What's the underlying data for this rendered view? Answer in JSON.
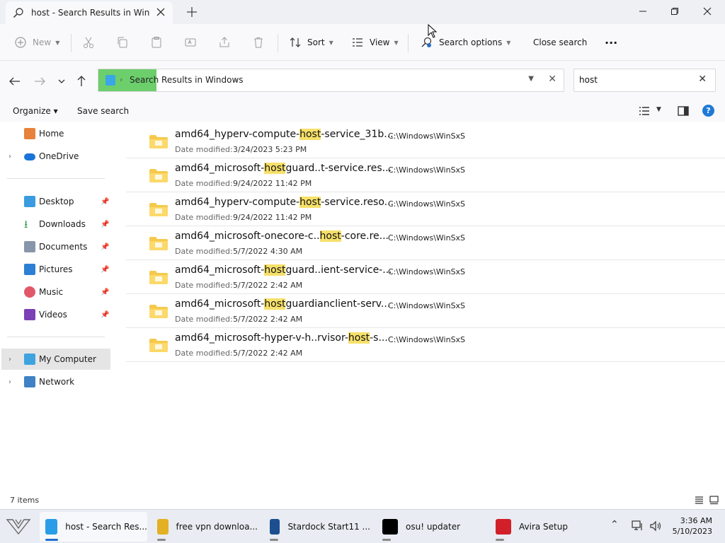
{
  "window": {
    "tab_title": "host - Search Results in Windows"
  },
  "toolbar": {
    "new_label": "New",
    "sort_label": "Sort",
    "view_label": "View",
    "search_options_label": "Search options",
    "close_search_label": "Close search",
    "more_label": "···"
  },
  "address": {
    "crumb": "Search Results in Windows"
  },
  "search": {
    "value": "host"
  },
  "commands": {
    "organize": "Organize",
    "save_search": "Save search"
  },
  "sidebar": {
    "items": [
      {
        "label": "Home",
        "icon": "home-icon",
        "color": "#e8813a"
      },
      {
        "label": "OneDrive",
        "icon": "cloud-icon",
        "color": "#1a73d9"
      },
      {
        "label": "Desktop",
        "icon": "desktop-icon",
        "color": "#3a9be0"
      },
      {
        "label": "Downloads",
        "icon": "download-icon",
        "color": "#2d9a4e"
      },
      {
        "label": "Documents",
        "icon": "document-icon",
        "color": "#7a8aa0"
      },
      {
        "label": "Pictures",
        "icon": "pictures-icon",
        "color": "#2b7fd4"
      },
      {
        "label": "Music",
        "icon": "music-icon",
        "color": "#e2566a"
      },
      {
        "label": "Videos",
        "icon": "video-icon",
        "color": "#7b3fb6"
      },
      {
        "label": "My Computer",
        "icon": "computer-icon",
        "color": "#3fa3e0"
      },
      {
        "label": "Network",
        "icon": "network-icon",
        "color": "#3f82c6"
      }
    ]
  },
  "files": {
    "date_label": "Date modified:",
    "items": [
      {
        "pre": "amd64_hyperv-compute-",
        "hl": "host",
        "post": "-service_31b...",
        "date": "3/24/2023 5:23 PM",
        "path": "C:\\Windows\\WinSxS"
      },
      {
        "pre": "amd64_microsoft-",
        "hl": "host",
        "post": "guard..t-service.res...",
        "date": "9/24/2022 11:42 PM",
        "path": "C:\\Windows\\WinSxS"
      },
      {
        "pre": "amd64_hyperv-compute-",
        "hl": "host",
        "post": "-service.reso...",
        "date": "9/24/2022 11:42 PM",
        "path": "C:\\Windows\\WinSxS"
      },
      {
        "pre": "amd64_microsoft-onecore-c..",
        "hl": "host",
        "post": "-core.re...",
        "date": "5/7/2022 4:30 AM",
        "path": "C:\\Windows\\WinSxS"
      },
      {
        "pre": "amd64_microsoft-",
        "hl": "host",
        "post": "guard..ient-service-...",
        "date": "5/7/2022 2:42 AM",
        "path": "C:\\Windows\\WinSxS"
      },
      {
        "pre": "amd64_microsoft-",
        "hl": "host",
        "post": "guardianclient-serv...",
        "date": "5/7/2022 2:42 AM",
        "path": "C:\\Windows\\WinSxS"
      },
      {
        "pre": "amd64_microsoft-hyper-v-h..rvisor-",
        "hl": "host",
        "post": "-s...",
        "date": "5/7/2022 2:42 AM",
        "path": "C:\\Windows\\WinSxS"
      }
    ]
  },
  "status": {
    "count": "7 items"
  },
  "taskbar": {
    "items": [
      {
        "label": "host - Search Res...",
        "color": "#2a9de8",
        "active": true
      },
      {
        "label": "free vpn downloa...",
        "color": "#e3b023",
        "active": false
      },
      {
        "label": "Stardock Start11 ...",
        "color": "#1c4f8f",
        "active": false
      },
      {
        "label": "osu! updater",
        "color": "#000000",
        "active": false
      },
      {
        "label": "Avira Setup",
        "color": "#d1202a",
        "active": false
      }
    ],
    "time": "3:36 AM",
    "date": "5/10/2023"
  },
  "colors": {
    "accent": "#1f6fd1",
    "highlight": "#f6e06a",
    "folder": "#f5c94c"
  }
}
